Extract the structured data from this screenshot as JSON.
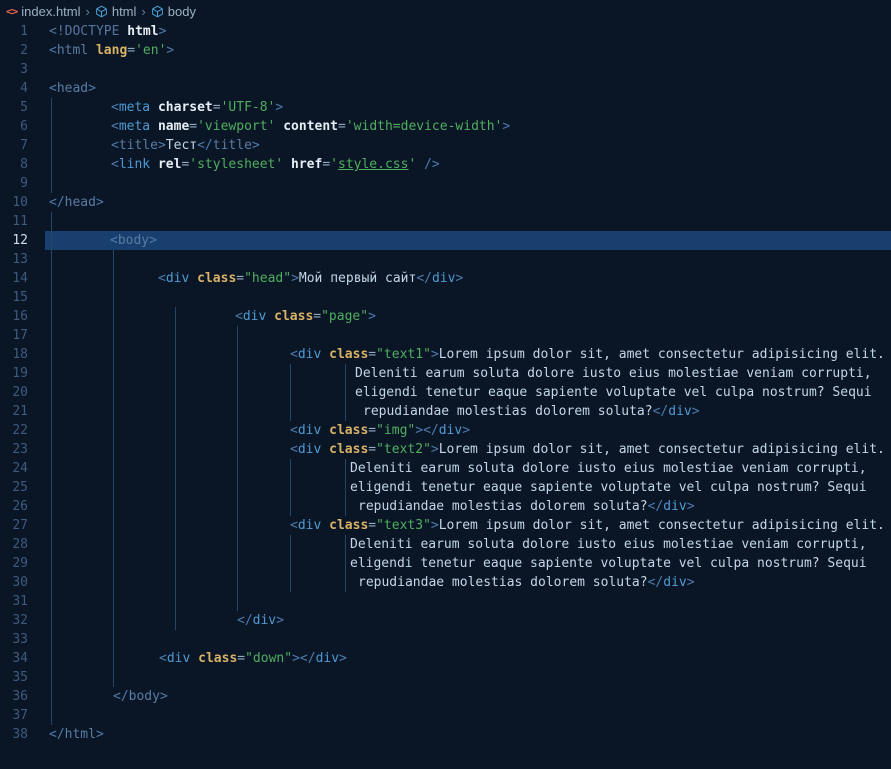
{
  "breadcrumb": {
    "separator": "›",
    "items": [
      {
        "label": "index.html",
        "icon": "html-file-icon"
      },
      {
        "label": "html",
        "icon": "symbol-element-icon"
      },
      {
        "label": "body",
        "icon": "symbol-element-icon"
      }
    ],
    "file_icon_glyph": "<>"
  },
  "editor": {
    "language": "html",
    "active_line": 12,
    "total_lines": 38,
    "palette": {
      "bg": "#0a1626",
      "hl": "#183f6d",
      "guide": "#234669",
      "ln": "#3e5a7e",
      "ln-active": "#d0dcea",
      "br": "#4d7cae",
      "tag": "#4f9ad2",
      "tagm": "#5a7ba3",
      "doc": "#54749c",
      "attr": "#e6edf5",
      "attrg": "#d9b266",
      "eq": "#93a9c0",
      "str": "#4fae5f",
      "txt": "#c3d5e8",
      "crumb-text": "#9db0c6",
      "crumb-sep": "#64809f",
      "crumb-orange": "#e8654a",
      "crumb-cube": "#4aa0d5"
    },
    "lines": [
      {
        "n": 1,
        "ind": 4,
        "g": [],
        "tk": [
          [
            "doc",
            "<!DOCTYPE "
          ],
          [
            "attr",
            "html"
          ],
          [
            "br",
            ">"
          ]
        ]
      },
      {
        "n": 2,
        "ind": 4,
        "g": [],
        "tk": [
          [
            "br",
            "<"
          ],
          [
            "tagm",
            "html"
          ],
          [
            "txt",
            " "
          ],
          [
            "attrg",
            "lang"
          ],
          [
            "eq",
            "="
          ],
          [
            "str",
            "'en'"
          ],
          [
            "br",
            ">"
          ]
        ]
      },
      {
        "n": 3,
        "ind": 0,
        "g": [],
        "tk": []
      },
      {
        "n": 4,
        "ind": 4,
        "g": [],
        "tk": [
          [
            "br",
            "<"
          ],
          [
            "tagm",
            "head"
          ],
          [
            "br",
            ">"
          ]
        ]
      },
      {
        "n": 5,
        "ind": 66,
        "g": [
          6
        ],
        "tk": [
          [
            "br",
            "<"
          ],
          [
            "tag",
            "meta"
          ],
          [
            "txt",
            " "
          ],
          [
            "attr",
            "charset"
          ],
          [
            "eq",
            "="
          ],
          [
            "str",
            "'UTF-8'"
          ],
          [
            "br",
            ">"
          ]
        ]
      },
      {
        "n": 6,
        "ind": 66,
        "g": [
          6
        ],
        "tk": [
          [
            "br",
            "<"
          ],
          [
            "tag",
            "meta"
          ],
          [
            "txt",
            " "
          ],
          [
            "attr",
            "name"
          ],
          [
            "eq",
            "="
          ],
          [
            "str",
            "'viewport'"
          ],
          [
            "txt",
            " "
          ],
          [
            "attr",
            "content"
          ],
          [
            "eq",
            "="
          ],
          [
            "str",
            "'width=device-width'"
          ],
          [
            "br",
            ">"
          ]
        ]
      },
      {
        "n": 7,
        "ind": 66,
        "g": [
          6
        ],
        "tk": [
          [
            "br",
            "<"
          ],
          [
            "tagm",
            "title"
          ],
          [
            "br",
            ">"
          ],
          [
            "txt",
            "Тест"
          ],
          [
            "br",
            "</"
          ],
          [
            "tagm",
            "title"
          ],
          [
            "br",
            ">"
          ]
        ]
      },
      {
        "n": 8,
        "ind": 66,
        "g": [
          6
        ],
        "tk": [
          [
            "br",
            "<"
          ],
          [
            "tag",
            "link"
          ],
          [
            "txt",
            " "
          ],
          [
            "attr",
            "rel"
          ],
          [
            "eq",
            "="
          ],
          [
            "str",
            "'stylesheet'"
          ],
          [
            "txt",
            " "
          ],
          [
            "attr",
            "href"
          ],
          [
            "eq",
            "="
          ],
          [
            "str",
            "'"
          ],
          [
            "lnk",
            "style.css"
          ],
          [
            "str",
            "'"
          ],
          [
            "txt",
            " "
          ],
          [
            "br",
            "/>"
          ]
        ]
      },
      {
        "n": 9,
        "ind": 0,
        "g": [
          6
        ],
        "tk": []
      },
      {
        "n": 10,
        "ind": 4,
        "g": [],
        "tk": [
          [
            "br",
            "</"
          ],
          [
            "tagm",
            "head"
          ],
          [
            "br",
            ">"
          ]
        ]
      },
      {
        "n": 11,
        "ind": 0,
        "g": [
          6
        ],
        "tk": []
      },
      {
        "n": 12,
        "ind": 65,
        "g": [
          6
        ],
        "tk": [
          [
            "br",
            "<"
          ],
          [
            "tagm",
            "body"
          ],
          [
            "br",
            ">"
          ]
        ]
      },
      {
        "n": 13,
        "ind": 0,
        "g": [
          6,
          68
        ],
        "tk": []
      },
      {
        "n": 14,
        "ind": 113,
        "g": [
          6,
          68
        ],
        "tk": [
          [
            "br",
            "<"
          ],
          [
            "tag",
            "div"
          ],
          [
            "txt",
            " "
          ],
          [
            "attrg",
            "class"
          ],
          [
            "eq",
            "="
          ],
          [
            "str",
            "\"head\""
          ],
          [
            "br",
            ">"
          ],
          [
            "txt",
            "Мой первый сайт"
          ],
          [
            "br",
            "</"
          ],
          [
            "tag",
            "div"
          ],
          [
            "br",
            ">"
          ]
        ]
      },
      {
        "n": 15,
        "ind": 0,
        "g": [
          6,
          68
        ],
        "tk": []
      },
      {
        "n": 16,
        "ind": 190,
        "g": [
          6,
          68,
          130
        ],
        "tk": [
          [
            "br",
            "<"
          ],
          [
            "tag",
            "div"
          ],
          [
            "txt",
            " "
          ],
          [
            "attrg",
            "class"
          ],
          [
            "eq",
            "="
          ],
          [
            "str",
            "\"page\""
          ],
          [
            "br",
            ">"
          ]
        ]
      },
      {
        "n": 17,
        "ind": 0,
        "g": [
          6,
          68,
          130,
          192
        ],
        "tk": []
      },
      {
        "n": 18,
        "ind": 245,
        "g": [
          6,
          68,
          130,
          192
        ],
        "tk": [
          [
            "br",
            "<"
          ],
          [
            "tag",
            "div"
          ],
          [
            "txt",
            " "
          ],
          [
            "attrg",
            "class"
          ],
          [
            "eq",
            "="
          ],
          [
            "str",
            "\"text1\""
          ],
          [
            "br",
            ">"
          ],
          [
            "txt",
            "Lorem ipsum dolor sit, amet consectetur adipisicing elit."
          ]
        ]
      },
      {
        "n": 19,
        "ind": 310,
        "g": [
          6,
          68,
          130,
          192,
          245,
          300
        ],
        "tk": [
          [
            "txt",
            "Deleniti earum soluta dolore iusto eius molestiae veniam corrupti,"
          ]
        ]
      },
      {
        "n": 20,
        "ind": 310,
        "g": [
          6,
          68,
          130,
          192,
          245,
          300
        ],
        "tk": [
          [
            "txt",
            "eligendi tenetur eaque sapiente voluptate vel culpa nostrum? Sequi"
          ]
        ]
      },
      {
        "n": 21,
        "ind": 318,
        "g": [
          6,
          68,
          130,
          192,
          245,
          300
        ],
        "tk": [
          [
            "txt",
            "repudiandae molestias dolorem soluta?"
          ],
          [
            "br",
            "</"
          ],
          [
            "tag",
            "div"
          ],
          [
            "br",
            ">"
          ]
        ]
      },
      {
        "n": 22,
        "ind": 245,
        "g": [
          6,
          68,
          130,
          192
        ],
        "tk": [
          [
            "br",
            "<"
          ],
          [
            "tag",
            "div"
          ],
          [
            "txt",
            " "
          ],
          [
            "attrg",
            "class"
          ],
          [
            "eq",
            "="
          ],
          [
            "str",
            "\"img\""
          ],
          [
            "br",
            "></"
          ],
          [
            "tag",
            "div"
          ],
          [
            "br",
            ">"
          ]
        ]
      },
      {
        "n": 23,
        "ind": 245,
        "g": [
          6,
          68,
          130,
          192
        ],
        "tk": [
          [
            "br",
            "<"
          ],
          [
            "tag",
            "div"
          ],
          [
            "txt",
            " "
          ],
          [
            "attrg",
            "class"
          ],
          [
            "eq",
            "="
          ],
          [
            "str",
            "\"text2\""
          ],
          [
            "br",
            ">"
          ],
          [
            "txt",
            "Lorem ipsum dolor sit, amet consectetur adipisicing elit."
          ]
        ]
      },
      {
        "n": 24,
        "ind": 305,
        "g": [
          6,
          68,
          130,
          192,
          245,
          300
        ],
        "tk": [
          [
            "txt",
            "Deleniti earum soluta dolore iusto eius molestiae veniam corrupti,"
          ]
        ]
      },
      {
        "n": 25,
        "ind": 305,
        "g": [
          6,
          68,
          130,
          192,
          245,
          300
        ],
        "tk": [
          [
            "txt",
            "eligendi tenetur eaque sapiente voluptate vel culpa nostrum? Sequi"
          ]
        ]
      },
      {
        "n": 26,
        "ind": 313,
        "g": [
          6,
          68,
          130,
          192,
          245,
          300
        ],
        "tk": [
          [
            "txt",
            "repudiandae molestias dolorem soluta?"
          ],
          [
            "br",
            "</"
          ],
          [
            "tag",
            "div"
          ],
          [
            "br",
            ">"
          ]
        ]
      },
      {
        "n": 27,
        "ind": 245,
        "g": [
          6,
          68,
          130,
          192
        ],
        "tk": [
          [
            "br",
            "<"
          ],
          [
            "tag",
            "div"
          ],
          [
            "txt",
            " "
          ],
          [
            "attrg",
            "class"
          ],
          [
            "eq",
            "="
          ],
          [
            "str",
            "\"text3\""
          ],
          [
            "br",
            ">"
          ],
          [
            "txt",
            "Lorem ipsum dolor sit, amet consectetur adipisicing elit."
          ]
        ]
      },
      {
        "n": 28,
        "ind": 305,
        "g": [
          6,
          68,
          130,
          192,
          245,
          300
        ],
        "tk": [
          [
            "txt",
            "Deleniti earum soluta dolore iusto eius molestiae veniam corrupti,"
          ]
        ]
      },
      {
        "n": 29,
        "ind": 305,
        "g": [
          6,
          68,
          130,
          192,
          245,
          300
        ],
        "tk": [
          [
            "txt",
            "eligendi tenetur eaque sapiente voluptate vel culpa nostrum? Sequi"
          ]
        ]
      },
      {
        "n": 30,
        "ind": 313,
        "g": [
          6,
          68,
          130,
          192,
          245,
          300
        ],
        "tk": [
          [
            "txt",
            "repudiandae molestias dolorem soluta?"
          ],
          [
            "br",
            "</"
          ],
          [
            "tag",
            "div"
          ],
          [
            "br",
            ">"
          ]
        ]
      },
      {
        "n": 31,
        "ind": 0,
        "g": [
          6,
          68,
          130,
          192
        ],
        "tk": []
      },
      {
        "n": 32,
        "ind": 192,
        "g": [
          6,
          68,
          130
        ],
        "tk": [
          [
            "br",
            "</"
          ],
          [
            "tag",
            "div"
          ],
          [
            "br",
            ">"
          ]
        ]
      },
      {
        "n": 33,
        "ind": 0,
        "g": [
          6,
          68
        ],
        "tk": []
      },
      {
        "n": 34,
        "ind": 114,
        "g": [
          6,
          68
        ],
        "tk": [
          [
            "br",
            "<"
          ],
          [
            "tag",
            "div"
          ],
          [
            "txt",
            " "
          ],
          [
            "attrg",
            "class"
          ],
          [
            "eq",
            "="
          ],
          [
            "str",
            "\"down\""
          ],
          [
            "br",
            "></"
          ],
          [
            "tag",
            "div"
          ],
          [
            "br",
            ">"
          ]
        ]
      },
      {
        "n": 35,
        "ind": 0,
        "g": [
          6,
          68
        ],
        "tk": []
      },
      {
        "n": 36,
        "ind": 68,
        "g": [
          6
        ],
        "tk": [
          [
            "br",
            "</"
          ],
          [
            "tagm",
            "body"
          ],
          [
            "br",
            ">"
          ]
        ]
      },
      {
        "n": 37,
        "ind": 0,
        "g": [
          6
        ],
        "tk": []
      },
      {
        "n": 38,
        "ind": 4,
        "g": [],
        "tk": [
          [
            "br",
            "</"
          ],
          [
            "tagm",
            "html"
          ],
          [
            "br",
            ">"
          ]
        ]
      }
    ]
  }
}
